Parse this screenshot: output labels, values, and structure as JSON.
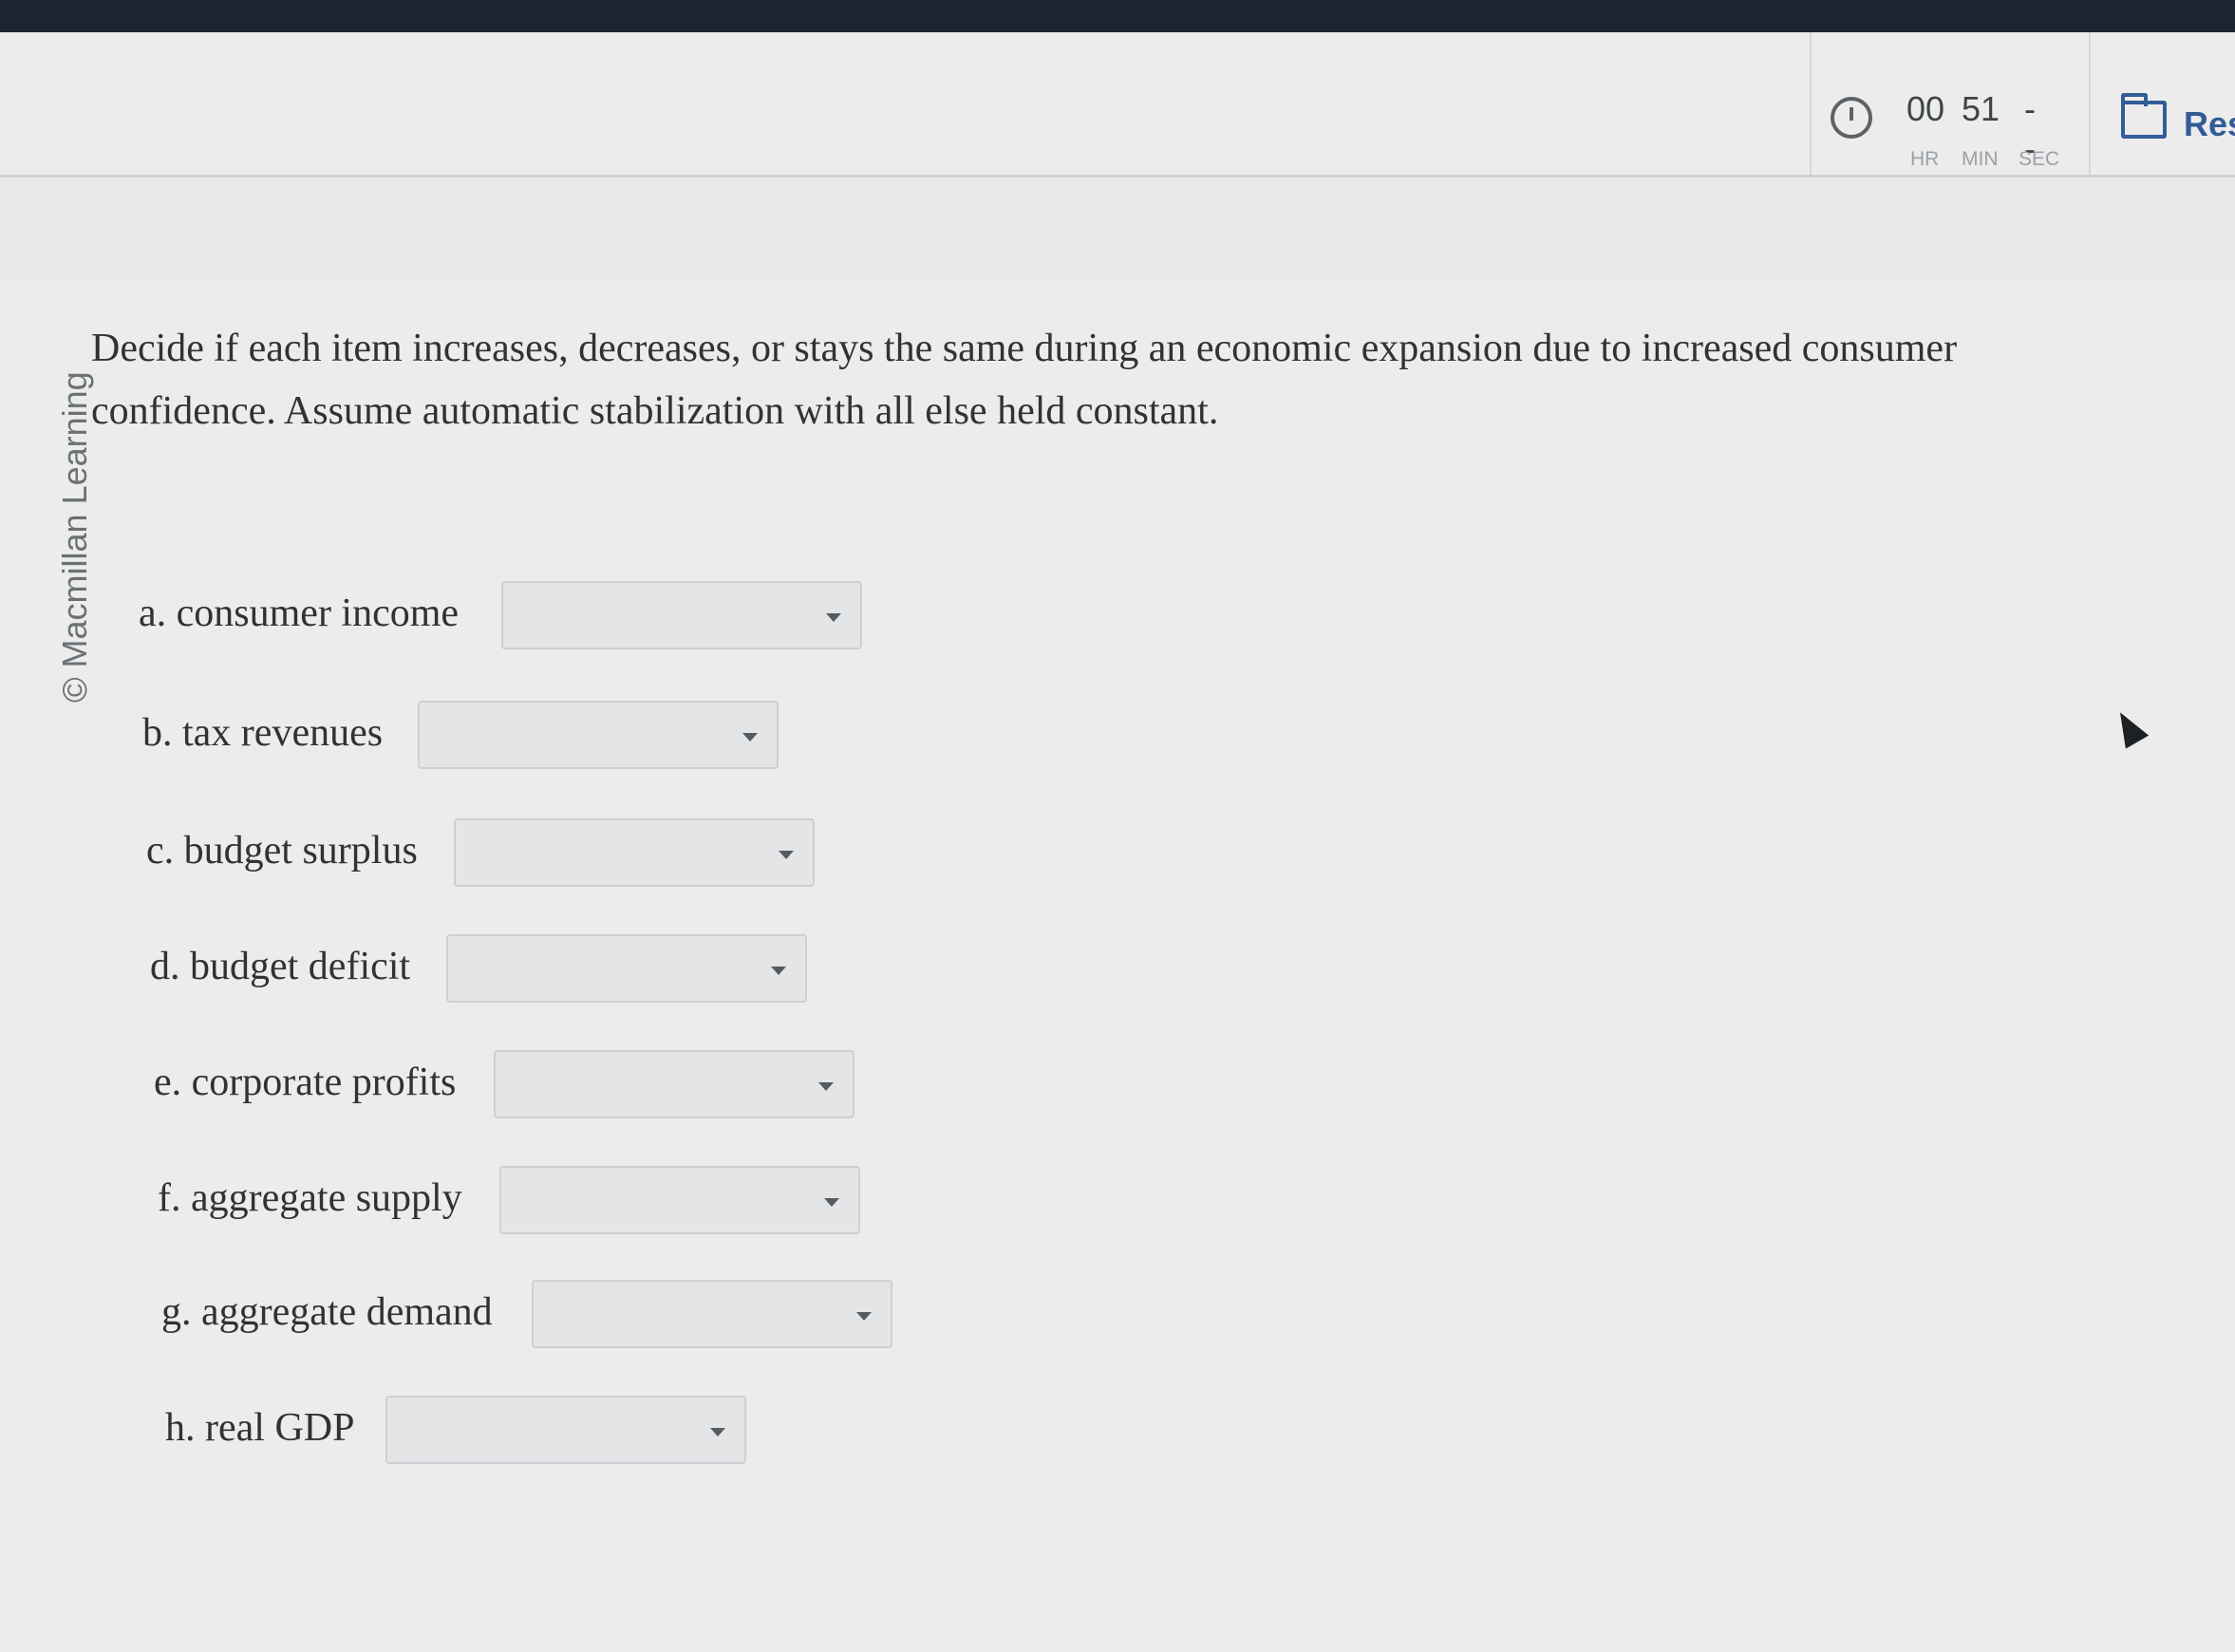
{
  "timer": {
    "hours": "00",
    "minutes": "51",
    "seconds": "--",
    "hours_label": "HR",
    "minutes_label": "MIN",
    "seconds_label": "SEC"
  },
  "header": {
    "resources_label": "Res"
  },
  "watermark": "© Macmillan Learning",
  "question": "Decide if each item increases, decreases, or stays the same during an economic expansion due to increased consumer confidence. Assume automatic stabilization with all else held constant.",
  "items": [
    {
      "label": "a. consumer income",
      "selected": ""
    },
    {
      "label": "b. tax revenues",
      "selected": ""
    },
    {
      "label": "c. budget surplus",
      "selected": ""
    },
    {
      "label": "d. budget deficit",
      "selected": ""
    },
    {
      "label": "e. corporate profits",
      "selected": ""
    },
    {
      "label": "f. aggregate supply",
      "selected": ""
    },
    {
      "label": "g. aggregate demand",
      "selected": ""
    },
    {
      "label": "h. real GDP",
      "selected": ""
    }
  ]
}
